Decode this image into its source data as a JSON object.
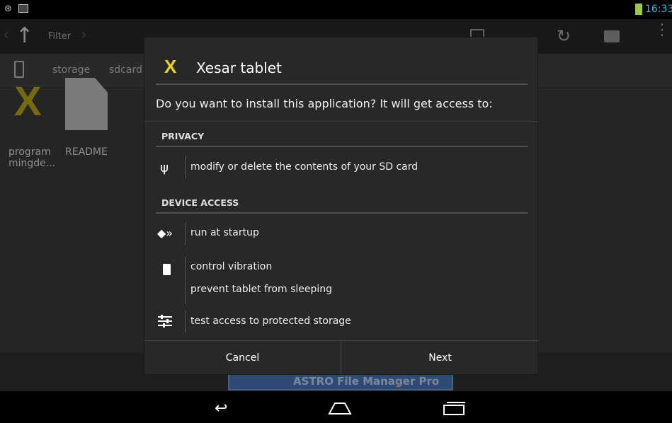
{
  "status_bar": {
    "time": "16:33"
  },
  "app": {
    "toolbar": {
      "filter_label": "Filter"
    },
    "breadcrumb": [
      "storage",
      "sdcard"
    ],
    "files": [
      {
        "name": "program mingde...",
        "line1": "program",
        "line2": "mingde...",
        "icon": "xesar-x-icon"
      },
      {
        "name": "README",
        "line1": "README",
        "line2": "",
        "icon": "document-icon"
      }
    ],
    "ad_text": "ASTRO File Manager Pro"
  },
  "dialog": {
    "app_icon_glyph": "X",
    "app_name": "Xesar tablet",
    "question": "Do you want to install this application? It will get access to:",
    "sections": [
      {
        "title": "PRIVACY",
        "groups": [
          {
            "icon": "usb-icon",
            "items": [
              "modify or delete the contents of your SD card"
            ]
          }
        ]
      },
      {
        "title": "DEVICE ACCESS",
        "groups": [
          {
            "icon": "startup-icon",
            "items": [
              "run at startup"
            ]
          },
          {
            "icon": "battery-icon",
            "items": [
              "control vibration",
              "prevent tablet from sleeping"
            ]
          },
          {
            "icon": "settings-sliders-icon",
            "items": [
              "test access to protected storage"
            ]
          }
        ]
      }
    ],
    "buttons": {
      "cancel": "Cancel",
      "next": "Next"
    }
  },
  "colors": {
    "accent_yellow": "#f2d20b",
    "clock_blue": "#33b5e5"
  }
}
